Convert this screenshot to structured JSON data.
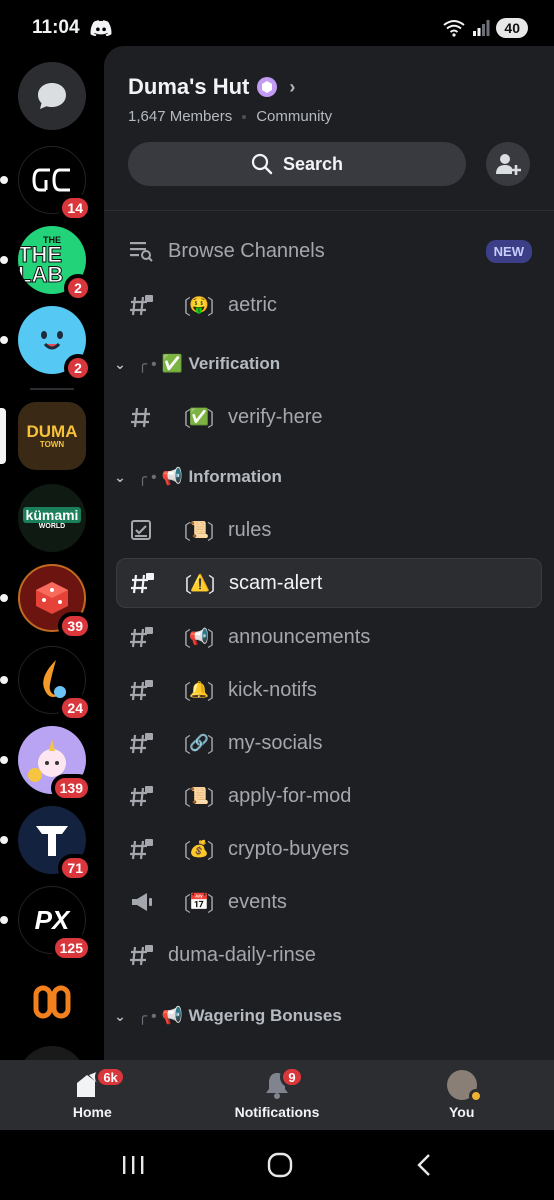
{
  "status": {
    "time": "11:04",
    "battery": "40"
  },
  "server": {
    "name": "Duma's Hut",
    "members": "1,647 Members",
    "type": "Community"
  },
  "search": {
    "label": "Search"
  },
  "servers": [
    {
      "badge": "14"
    },
    {
      "label": "THE LAB",
      "badge": "2"
    },
    {
      "badge": "2"
    },
    {
      "label": "DUMA",
      "sublabel": "TOWN"
    },
    {
      "label": "kümami",
      "sublabel": "WORLD"
    },
    {
      "badge": "39"
    },
    {
      "badge": "24"
    },
    {
      "badge": "139"
    },
    {
      "badge": "71"
    },
    {
      "label": "PX",
      "badge": "125"
    },
    {},
    {}
  ],
  "browse": {
    "label": "Browse Channels",
    "badge": "NEW"
  },
  "channels_top": [
    {
      "emoji": "🤑",
      "name": "aetric"
    }
  ],
  "categories": [
    {
      "emoji": "✅",
      "name": "Verification"
    },
    {
      "emoji": "📢",
      "name": "Information"
    },
    {
      "emoji": "📢",
      "name": "Wagering Bonuses"
    }
  ],
  "verification_channels": [
    {
      "emoji": "✅",
      "name": "verify-here"
    }
  ],
  "information_channels": [
    {
      "emoji": "📜",
      "name": "rules"
    },
    {
      "emoji": "⚠️",
      "name": "scam-alert"
    },
    {
      "emoji": "📢",
      "name": "announcements"
    },
    {
      "emoji": "🔔",
      "name": "kick-notifs"
    },
    {
      "emoji": "🔗",
      "name": "my-socials"
    },
    {
      "emoji": "📜",
      "name": "apply-for-mod"
    },
    {
      "emoji": "💰",
      "name": "crypto-buyers"
    },
    {
      "emoji": "📅",
      "name": "events"
    },
    {
      "name": "duma-daily-rinse"
    }
  ],
  "bottom_nav": {
    "home": {
      "label": "Home",
      "badge": "6k"
    },
    "notifications": {
      "label": "Notifications",
      "badge": "9"
    },
    "you": {
      "label": "You"
    }
  }
}
